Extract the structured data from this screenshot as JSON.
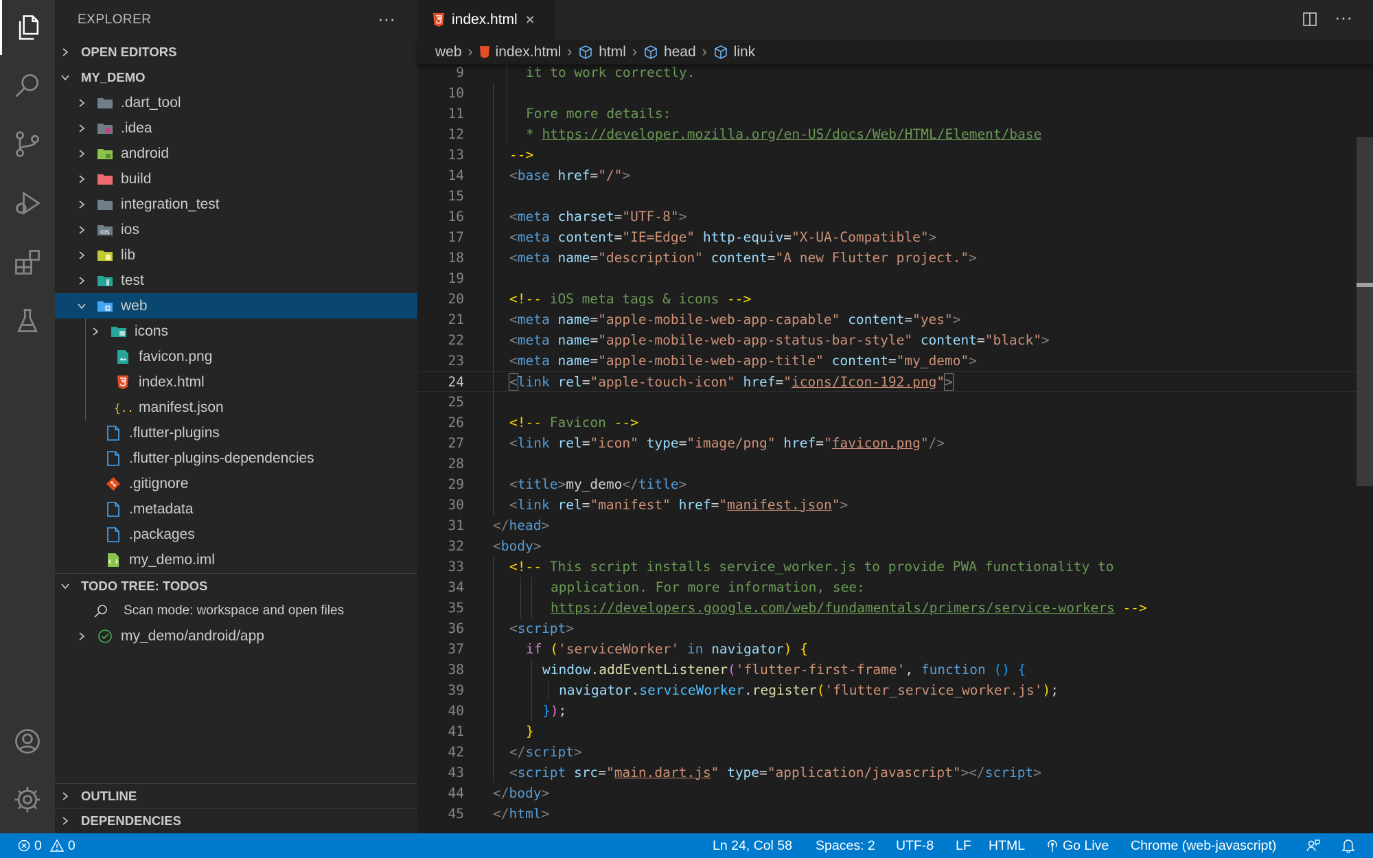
{
  "activity_bar": {
    "icons": [
      "explorer-icon",
      "search-icon",
      "source-control-icon",
      "run-debug-icon",
      "extensions-icon",
      "testing-icon",
      "accounts-icon",
      "manage-gear-icon"
    ]
  },
  "sidebar": {
    "title": "EXPLORER",
    "more": "···",
    "open_editors": "OPEN EDITORS",
    "project": "MY_DEMO",
    "tree": [
      {
        "label": ".dart_tool",
        "kind": "folder"
      },
      {
        "label": ".idea",
        "kind": "folder"
      },
      {
        "label": "android",
        "kind": "folder"
      },
      {
        "label": "build",
        "kind": "folder"
      },
      {
        "label": "integration_test",
        "kind": "folder"
      },
      {
        "label": "ios",
        "kind": "folder"
      },
      {
        "label": "lib",
        "kind": "folder"
      },
      {
        "label": "test",
        "kind": "folder"
      },
      {
        "label": "web",
        "kind": "folder-open"
      },
      {
        "label": "icons",
        "kind": "folder"
      },
      {
        "label": "favicon.png",
        "kind": "file"
      },
      {
        "label": "index.html",
        "kind": "file"
      },
      {
        "label": "manifest.json",
        "kind": "file"
      },
      {
        "label": ".flutter-plugins",
        "kind": "file"
      },
      {
        "label": ".flutter-plugins-dependencies",
        "kind": "file"
      },
      {
        "label": ".gitignore",
        "kind": "file"
      },
      {
        "label": ".metadata",
        "kind": "file"
      },
      {
        "label": ".packages",
        "kind": "file"
      },
      {
        "label": "my_demo.iml",
        "kind": "file"
      }
    ],
    "todo_tree": "TODO TREE: TODOS",
    "todo_scan": "Scan mode: workspace and open files",
    "todo_item": "my_demo/android/app",
    "outline": "OUTLINE",
    "dependencies": "DEPENDENCIES"
  },
  "editor": {
    "tab_label": "index.html",
    "tab_close": "×",
    "breadcrumb": [
      "web",
      "index.html",
      "html",
      "head",
      "link"
    ],
    "current_line": "24"
  },
  "code": {
    "line_numbers": [
      "9",
      "10",
      "11",
      "12",
      "13",
      "14",
      "15",
      "16",
      "17",
      "18",
      "19",
      "20",
      "21",
      "22",
      "23",
      "24",
      "25",
      "26",
      "27",
      "28",
      "29",
      "30",
      "31",
      "32",
      "33",
      "34",
      "35",
      "36",
      "37",
      "38",
      "39",
      "40",
      "41",
      "42",
      "43",
      "44",
      "45"
    ],
    "l9": "it to work correctly.",
    "l11": "Fore more details:",
    "l12a": "* ",
    "l12b": "https://developer.mozilla.org/en-US/docs/Web/HTML/Element/base",
    "l13": "-->",
    "l20a": "<!--",
    "l20b": " iOS meta tags & icons ",
    "l20c": "-->",
    "l26a": "<!--",
    "l26b": " Favicon ",
    "l26c": "-->",
    "l33a": "<!--",
    "l33b": " This script installs service_worker.js to provide PWA functionality to",
    "l34": "application. For more information, see:",
    "l35a": "https://developers.google.com/web/fundamentals/primers/service-workers",
    "l35b": " -->",
    "s_base": "base",
    "s_href": "href",
    "s_slash": "\"/\"",
    "s_meta": "meta",
    "s_charset": "charset",
    "s_utf8": "\"UTF-8\"",
    "s_content": "content",
    "s_ieedge": "\"IE=Edge\"",
    "s_httpequiv": "http-equiv",
    "s_xua": "\"X-UA-Compatible\"",
    "s_name": "name",
    "s_description": "\"description\"",
    "s_newflutter": "\"A new Flutter project.\"",
    "s_amwac": "\"apple-mobile-web-app-capable\"",
    "s_yes": "\"yes\"",
    "s_amwasbs": "\"apple-mobile-web-app-status-bar-style\"",
    "s_black": "\"black\"",
    "s_amwat": "\"apple-mobile-web-app-title\"",
    "s_mydemo": "\"my_demo\"",
    "s_link": "link",
    "s_rel": "rel",
    "s_ati": "\"apple-touch-icon\"",
    "s_icon192": "icons/Icon-192.png",
    "s_icon": "\"icon\"",
    "s_type": "type",
    "s_imagepng": "\"image/png\"",
    "s_faviconpng": "favicon.png",
    "s_title": "title",
    "s_titletext": "my_demo",
    "s_manifest": "\"manifest\"",
    "s_manifestjson": "manifest.json",
    "s_head": "head",
    "s_body": "body",
    "s_html": "html",
    "s_script": "script",
    "s_if": "if",
    "s_sw": "'serviceWorker'",
    "s_in": "in",
    "s_navigator": "navigator",
    "s_window": "window",
    "s_addEL": "addEventListener",
    "s_ffframe": "'flutter-first-frame'",
    "s_function": "function",
    "s_serviceWorker": "serviceWorker",
    "s_register": "register",
    "s_fswjs": "'flutter_service_worker.js'",
    "s_src": "src",
    "s_maindart": "main.dart.js",
    "s_appjs": "\"application/javascript\""
  },
  "status_bar": {
    "errors": "0",
    "warnings": "0",
    "position": "Ln 24, Col 58",
    "spaces": "Spaces: 2",
    "encoding": "UTF-8",
    "eol": "LF",
    "language": "HTML",
    "golive": "Go Live",
    "debug": "Chrome (web-javascript)"
  }
}
